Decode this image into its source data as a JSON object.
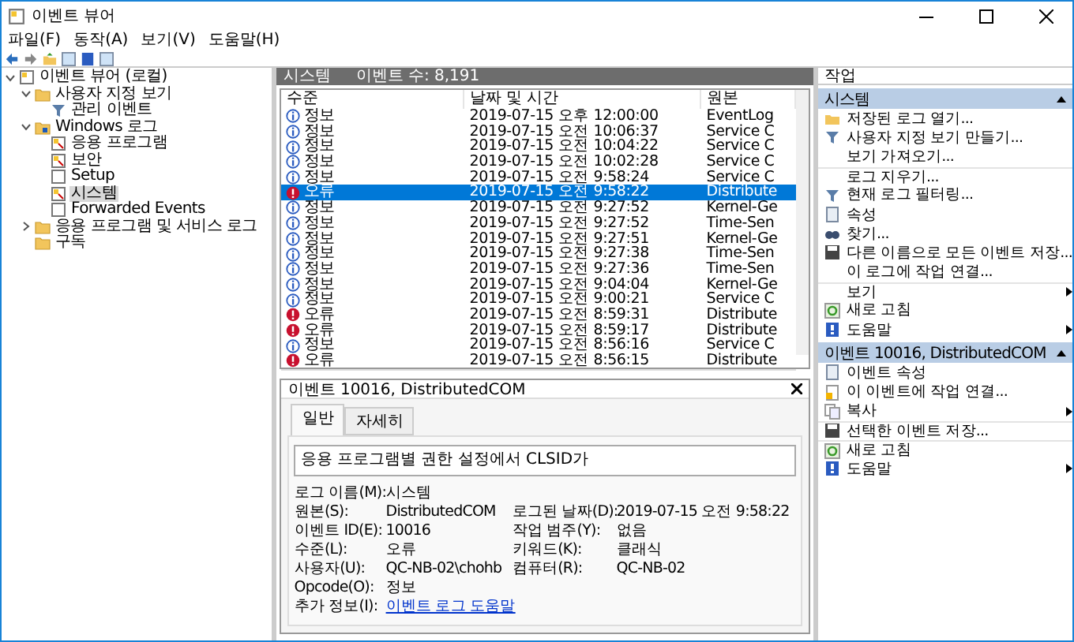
{
  "window": {
    "title": "이벤트 뷰어"
  },
  "menu": [
    "파일(F)",
    "동작(A)",
    "보기(V)",
    "도움말(H)"
  ],
  "tree": [
    {
      "label": "이벤트 뷰어 (로컬)",
      "kind": "root",
      "expanded": true,
      "selected": false,
      "children": [
        {
          "label": "사용자 지정 보기",
          "kind": "folder",
          "expanded": true,
          "selected": false,
          "children": [
            {
              "label": "관리 이벤트",
              "kind": "filter",
              "selected": false
            }
          ]
        },
        {
          "label": "Windows 로그",
          "kind": "winfolder",
          "expanded": true,
          "selected": false,
          "children": [
            {
              "label": "응용 프로그램",
              "kind": "log",
              "selected": false
            },
            {
              "label": "보안",
              "kind": "log",
              "selected": false
            },
            {
              "label": "Setup",
              "kind": "plain",
              "selected": false
            },
            {
              "label": "시스템",
              "kind": "log",
              "selected": true
            },
            {
              "label": "Forwarded Events",
              "kind": "plain",
              "selected": false
            }
          ]
        },
        {
          "label": "응용 프로그램 및 서비스 로그",
          "kind": "folder",
          "expanded": false,
          "selected": false
        },
        {
          "label": "구독",
          "kind": "folder",
          "selected": false
        }
      ]
    }
  ],
  "list": {
    "title": "시스템",
    "count": "이벤트 수: 8,191",
    "columns": [
      "수준",
      "날짜 및 시간",
      "원본"
    ],
    "rows": [
      {
        "kind": "info",
        "severity": "정보",
        "time": "2019-07-15 오후 12:00:00",
        "source": "EventLog",
        "selected": false
      },
      {
        "kind": "info",
        "severity": "정보",
        "time": "2019-07-15 오전 10:06:37",
        "source": "Service C",
        "selected": false
      },
      {
        "kind": "info",
        "severity": "정보",
        "time": "2019-07-15 오전 10:04:22",
        "source": "Service C",
        "selected": false
      },
      {
        "kind": "info",
        "severity": "정보",
        "time": "2019-07-15 오전 10:02:28",
        "source": "Service C",
        "selected": false
      },
      {
        "kind": "info",
        "severity": "정보",
        "time": "2019-07-15 오전 9:58:24",
        "source": "Service C",
        "selected": false
      },
      {
        "kind": "error",
        "severity": "오류",
        "time": "2019-07-15 오전 9:58:22",
        "source": "Distribute",
        "selected": true
      },
      {
        "kind": "info",
        "severity": "정보",
        "time": "2019-07-15 오전 9:27:52",
        "source": "Kernel-Ge",
        "selected": false
      },
      {
        "kind": "info",
        "severity": "정보",
        "time": "2019-07-15 오전 9:27:52",
        "source": "Time-Sen",
        "selected": false
      },
      {
        "kind": "info",
        "severity": "정보",
        "time": "2019-07-15 오전 9:27:51",
        "source": "Kernel-Ge",
        "selected": false
      },
      {
        "kind": "info",
        "severity": "정보",
        "time": "2019-07-15 오전 9:27:38",
        "source": "Time-Sen",
        "selected": false
      },
      {
        "kind": "info",
        "severity": "정보",
        "time": "2019-07-15 오전 9:27:36",
        "source": "Time-Sen",
        "selected": false
      },
      {
        "kind": "info",
        "severity": "정보",
        "time": "2019-07-15 오전 9:04:04",
        "source": "Kernel-Ge",
        "selected": false
      },
      {
        "kind": "info",
        "severity": "정보",
        "time": "2019-07-15 오전 9:00:21",
        "source": "Service C",
        "selected": false
      },
      {
        "kind": "error",
        "severity": "오류",
        "time": "2019-07-15 오전 8:59:31",
        "source": "Distribute",
        "selected": false
      },
      {
        "kind": "error",
        "severity": "오류",
        "time": "2019-07-15 오전 8:59:17",
        "source": "Distribute",
        "selected": false
      },
      {
        "kind": "info",
        "severity": "정보",
        "time": "2019-07-15 오전 8:56:16",
        "source": "Service C",
        "selected": false
      },
      {
        "kind": "error",
        "severity": "오류",
        "time": "2019-07-15 오전 8:56:15",
        "source": "Distribute",
        "selected": false
      }
    ]
  },
  "detail": {
    "title": "이벤트 10016, DistributedCOM",
    "tabs": [
      {
        "label": "일반",
        "selected": true
      },
      {
        "label": "자세히",
        "selected": false
      }
    ],
    "description": "응용 프로그램별 권한 설정에서 CLSID가",
    "fields": [
      {
        "label": "로그 이름(M):",
        "value": "시스템"
      },
      {
        "label": "원본(S):",
        "value": "DistributedCOM",
        "label2": "로그된 날짜(D):",
        "value2": "2019-07-15 오전 9:58:22"
      },
      {
        "label": "이벤트 ID(E):",
        "value": "10016",
        "label2": "작업 범주(Y):",
        "value2": "없음"
      },
      {
        "label": "수준(L):",
        "value": "오류",
        "label2": "키워드(K):",
        "value2": "클래식"
      },
      {
        "label": "사용자(U):",
        "value": "QC-NB-02\\chohb",
        "label2": "컴퓨터(R):",
        "value2": "QC-NB-02"
      },
      {
        "label": "Opcode(O):",
        "value": "정보"
      },
      {
        "label": "추가 정보(I):",
        "link": "이벤트 로그 도움말"
      }
    ]
  },
  "actions": {
    "title": "작업",
    "sections": [
      {
        "title": "시스템",
        "items": [
          {
            "label": "저장된 로그 열기...",
            "kind": "open"
          },
          {
            "label": "사용자 지정 보기 만들기...",
            "kind": "filter"
          },
          {
            "label": "보기 가져오기...",
            "kind": "none"
          },
          {
            "label": "로그 지우기...",
            "kind": "none",
            "separator": true
          },
          {
            "label": "현재 로그 필터링...",
            "kind": "filter"
          },
          {
            "label": "속성",
            "kind": "props"
          },
          {
            "label": "찾기...",
            "kind": "find"
          },
          {
            "label": "다른 이름으로 모든 이벤트 저장...",
            "kind": "save"
          },
          {
            "label": "이 로그에 작업 연결...",
            "kind": "none"
          },
          {
            "label": "보기",
            "kind": "none",
            "submenu": true,
            "separator": true
          },
          {
            "label": "새로 고침",
            "kind": "refresh"
          },
          {
            "label": "도움말",
            "kind": "help",
            "submenu": true
          }
        ]
      },
      {
        "title": "이벤트 10016, DistributedCOM",
        "items": [
          {
            "label": "이벤트 속성",
            "kind": "props"
          },
          {
            "label": "이 이벤트에 작업 연결...",
            "kind": "attach"
          },
          {
            "label": "복사",
            "kind": "copy",
            "submenu": true
          },
          {
            "label": "선택한 이벤트 저장...",
            "kind": "save",
            "separator": true
          },
          {
            "label": "새로 고침",
            "kind": "refresh",
            "separator": true
          },
          {
            "label": "도움말",
            "kind": "help",
            "submenu": true
          }
        ]
      }
    ]
  }
}
